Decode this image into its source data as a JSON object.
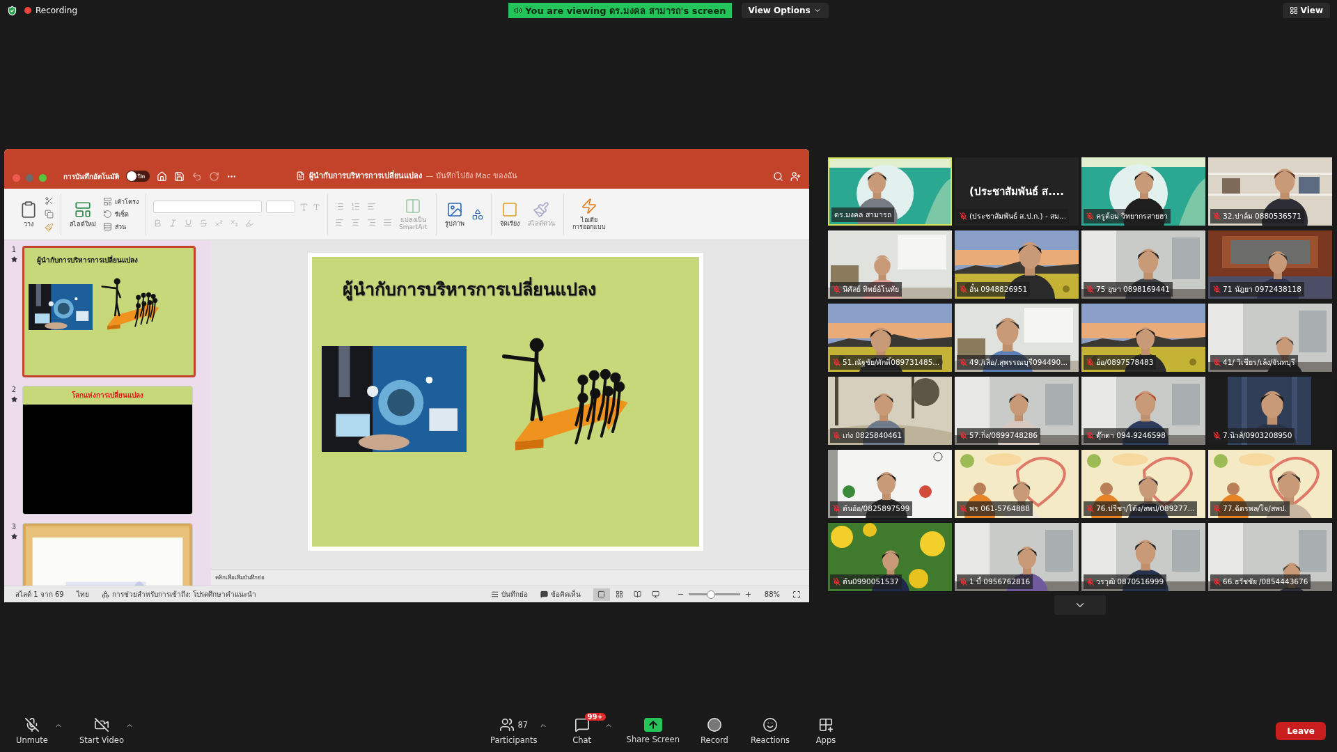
{
  "top_bar": {
    "recording": "Recording",
    "banner": "You are viewing ดร.มงคล สามารถ's screen",
    "view_options": "View Options",
    "view": "View"
  },
  "powerpoint": {
    "autosave_label": "การบันทึกอัตโนมัติ",
    "autosave_toggle": {
      "label": "ปิด",
      "on": false
    },
    "title": "ผู้นำกับการบริหารการเปลี่ยนแปลง",
    "save_location": "— บันทึกไปยัง Mac ของฉัน",
    "ribbon": {
      "paste": "วาง",
      "new_slide": "สไลด์ใหม่",
      "layout": "เค้าโครง",
      "reset": "รีเซ็ต",
      "section": "ส่วน",
      "smartart": [
        "แปลงเป็น",
        "SmartArt"
      ],
      "picture": "รูปภาพ",
      "arrange": "จัดเรียง",
      "quick_styles": "สไลด์ด่วน",
      "designer": [
        "ไอเดีย",
        "การออกแบบ"
      ]
    },
    "slides": [
      {
        "number": "1",
        "title": "ผู้นำกับการบริหารการเปลี่ยนแปลง",
        "kind": "title-pictures",
        "selected": true
      },
      {
        "number": "2",
        "title": "โลกแห่งการเปลี่ยนแปลง",
        "kind": "title-black",
        "selected": false
      },
      {
        "number": "3",
        "kind": "picture",
        "selected": false
      }
    ],
    "current_slide": {
      "title": "ผู้นำกับการบริหารการเปลี่ยนแปลง"
    },
    "notes_placeholder": "คลิกเพื่อเพิ่มบันทึกย่อ",
    "status_bar": {
      "slide_count": "สไลด์ 1 จาก 69",
      "language": "ไทย",
      "accessibility": "การช่วยสำหรับการเข้าถึง: โปรดศึกษาคำแนะนำ",
      "notes": "บันทึกย่อ",
      "comments": "ข้อคิดเห็น",
      "views": [
        {
          "selected": true
        },
        {
          "selected": false
        },
        {
          "selected": false
        },
        {
          "selected": false
        }
      ],
      "zoom": {
        "level": 0.43,
        "reading": "88%"
      }
    }
  },
  "tiles": [
    {
      "kind": "picture",
      "name": "ดร.มงคล สามารถ",
      "muted": false,
      "speaking": true
    },
    {
      "kind": "name",
      "display_name": "(ประชาสัมพันธ์ ส....",
      "name": "(ประชาสัมพันธ์ ส.ป.ก.) - สม...",
      "muted": true,
      "speaking": false
    },
    {
      "kind": "picture",
      "name": "ครูต้อม วิทยากรสายฮา",
      "muted": true,
      "speaking": false
    },
    {
      "kind": "picture",
      "name": "32.ปาล์ม 0880536571",
      "muted": true,
      "speaking": false
    },
    {
      "kind": "picture",
      "name": "นิศัลย์ ทิพย์อ์โนทัย",
      "muted": true,
      "speaking": false
    },
    {
      "kind": "picture",
      "name": "อั๋น 0948826951",
      "muted": true,
      "speaking": false
    },
    {
      "kind": "picture",
      "name": "75 อุษา 0898169441",
      "muted": true,
      "speaking": false
    },
    {
      "kind": "picture",
      "name": "71 นัฎยา 0972438118",
      "muted": true,
      "speaking": false
    },
    {
      "kind": "picture",
      "name": "51.ณัฐชัย/ศักดิ์089731485...",
      "muted": true,
      "speaking": false
    },
    {
      "kind": "picture",
      "name": "49./เสือ/.สุพรรณบุรี094490...",
      "muted": true,
      "speaking": false
    },
    {
      "kind": "picture",
      "name": "อ้อ/0897578483",
      "muted": true,
      "speaking": false
    },
    {
      "kind": "picture",
      "name": "41/ วิเชียร/เล้ง/จันทบุรี",
      "muted": true,
      "speaking": false
    },
    {
      "kind": "picture",
      "name": "เก่ง 0825840461",
      "muted": true,
      "speaking": false
    },
    {
      "kind": "picture",
      "name": "57.กิ่ง/0899748286",
      "muted": true,
      "speaking": false
    },
    {
      "kind": "picture",
      "name": "ตุ๊กตา 094-9246598",
      "muted": true,
      "speaking": false
    },
    {
      "kind": "picture",
      "name": "7.นิวส์/0903208950",
      "muted": true,
      "speaking": false
    },
    {
      "kind": "picture",
      "name": "ต้นอ้อ/0825897599",
      "muted": true,
      "speaking": false
    },
    {
      "kind": "picture",
      "name": "พร 061-5764888",
      "muted": true,
      "speaking": false
    },
    {
      "kind": "picture",
      "name": "76.ปรีชา/โต้ง/สพป/089277...",
      "muted": true,
      "speaking": false
    },
    {
      "kind": "picture",
      "name": "77.ฉัตรพล/โจ/สพป.",
      "muted": true,
      "speaking": false
    },
    {
      "kind": "picture",
      "name": "ต้น0990051537",
      "muted": true,
      "speaking": false
    },
    {
      "kind": "picture",
      "name": "1 บี้ 0956762816",
      "muted": true,
      "speaking": false
    },
    {
      "kind": "picture",
      "name": "วรวุฒิ 0870516999",
      "muted": true,
      "speaking": false
    },
    {
      "kind": "picture",
      "name": "66.ธวัชชัย /0854443676",
      "muted": true,
      "speaking": false
    }
  ],
  "toolbar": {
    "left": [
      {
        "kind": "mic",
        "label": "Unmute",
        "caret": true
      },
      {
        "kind": "video",
        "label": "Start Video",
        "caret": true
      }
    ],
    "center": [
      {
        "kind": "participants",
        "label": "Participants",
        "count": "87",
        "caret": true
      },
      {
        "kind": "chat",
        "label": "Chat",
        "badge": "99+",
        "caret": true
      },
      {
        "kind": "share",
        "label": "Share Screen",
        "caret": false
      },
      {
        "kind": "record",
        "label": "Record",
        "caret": false
      },
      {
        "kind": "reactions",
        "label": "Reactions",
        "caret": false
      },
      {
        "kind": "apps",
        "label": "Apps",
        "caret": false
      }
    ],
    "leave": "Leave"
  }
}
